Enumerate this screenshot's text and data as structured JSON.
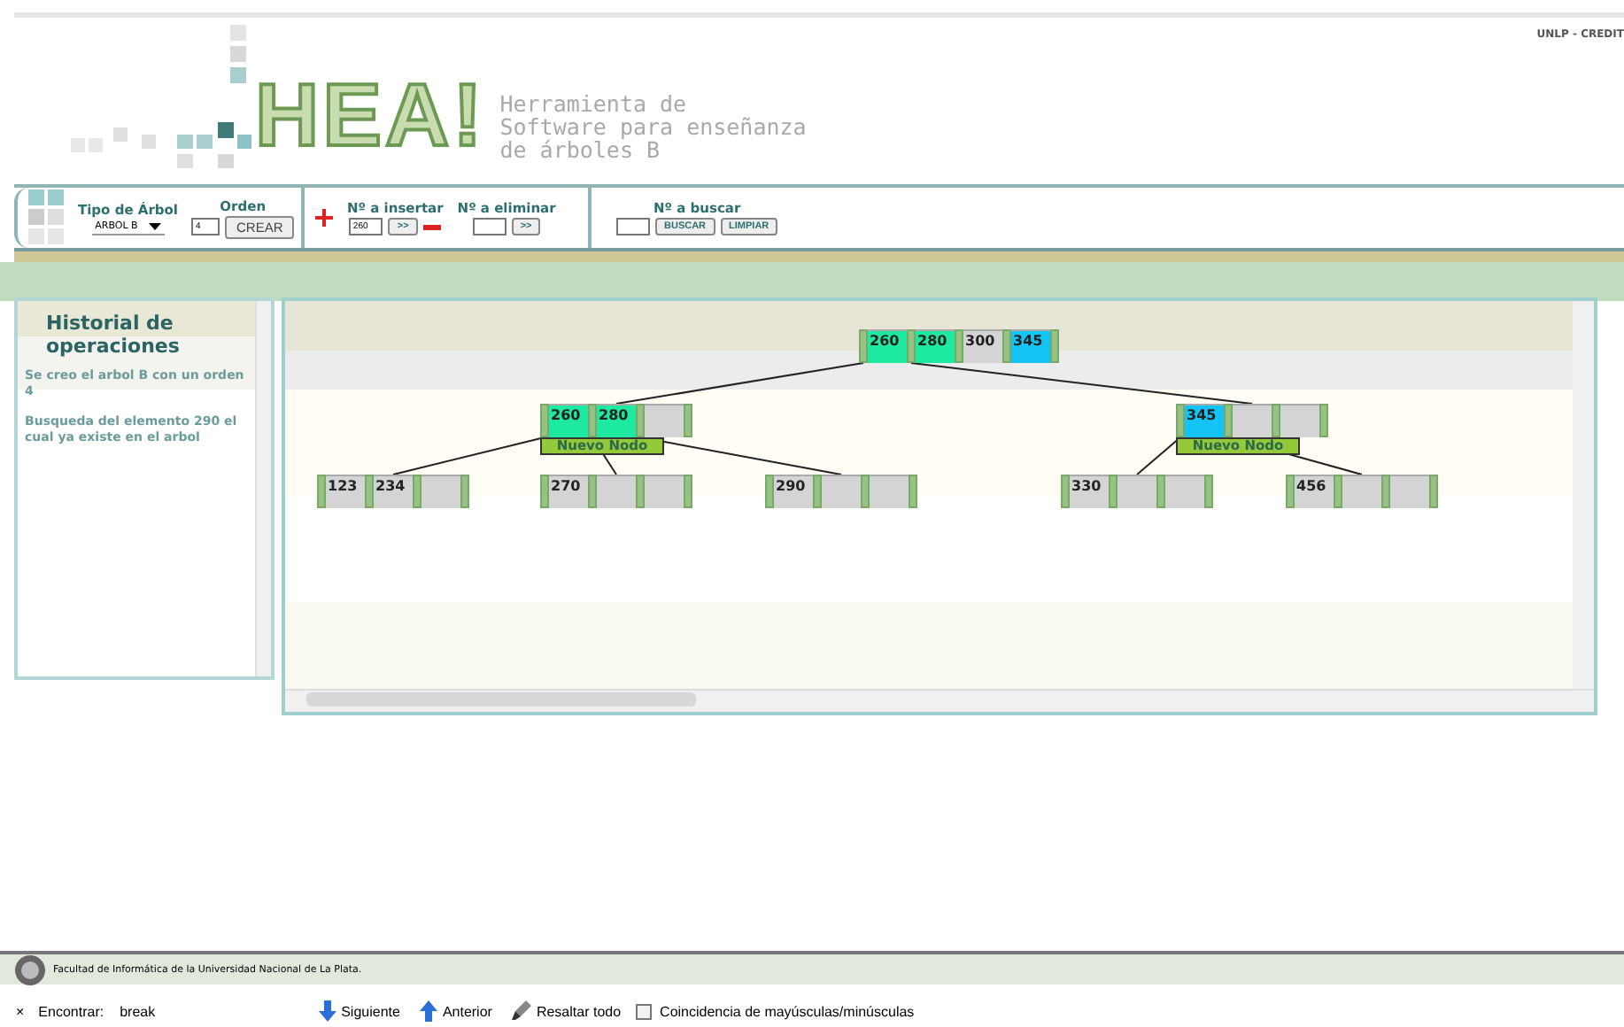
{
  "header": {
    "logo_text": "HEA!",
    "subtitle_lines": [
      "Herramienta de",
      "Software para enseñanza",
      "de árboles B"
    ],
    "credits_link": "UNLP - CREDIT"
  },
  "toolbar": {
    "tree_type": {
      "label": "Tipo de Árbol",
      "value": "ARBOL B"
    },
    "order": {
      "label": "Orden",
      "value": "4"
    },
    "create_button": "CREAR",
    "insert": {
      "label": "Nº a insertar",
      "value": "260",
      "button": ">>"
    },
    "delete": {
      "label": "Nº a eliminar",
      "button": ">>"
    },
    "search": {
      "label": "Nº a buscar",
      "buttons": [
        "BUSCAR",
        "LIMPIAR"
      ]
    }
  },
  "history": {
    "title": "Historial de operaciones",
    "entries": [
      "Se creo el arbol B con un orden 4",
      "Busqueda del elemento 290 el cual ya existe en el arbol"
    ]
  },
  "tree": {
    "root": {
      "keys": [
        {
          "value": "260",
          "color": "#1de9a0"
        },
        {
          "value": "280",
          "color": "#1de9a0"
        },
        {
          "value": "300",
          "color": "#d4d4d4"
        },
        {
          "value": "345",
          "color": "#13c4f5"
        }
      ],
      "children": [
        {
          "keys": [
            {
              "value": "260",
              "color": "#1de9a0"
            },
            {
              "value": "280",
              "color": "#1de9a0"
            }
          ],
          "label": "Nuevo Nodo",
          "children": [
            {
              "keys": [
                {
                  "value": "123",
                  "color": "#d4d4d4"
                },
                {
                  "value": "234",
                  "color": "#d4d4d4"
                }
              ]
            },
            {
              "keys": [
                {
                  "value": "270",
                  "color": "#d4d4d4"
                }
              ]
            },
            {
              "keys": [
                {
                  "value": "290",
                  "color": "#d4d4d4"
                }
              ]
            }
          ]
        },
        {
          "keys": [
            {
              "value": "345",
              "color": "#13c4f5"
            }
          ],
          "label": "Nuevo Nodo",
          "children": [
            {
              "keys": [
                {
                  "value": "330",
                  "color": "#d4d4d4"
                }
              ]
            },
            {
              "keys": [
                {
                  "value": "456",
                  "color": "#d4d4d4"
                }
              ]
            }
          ]
        }
      ]
    }
  },
  "status_bar": "Facultad de Informática de la Universidad Nacional de La Plata.",
  "find_bar": {
    "close": "×",
    "label": "Encontrar:",
    "value": "break",
    "buttons": [
      {
        "label": "Siguiente",
        "kind": "down"
      },
      {
        "label": "Anterior",
        "kind": "up"
      },
      {
        "label": "Resaltar todo",
        "kind": "highlight"
      }
    ],
    "match_case": {
      "label": "Coincidencia de mayúsculas/minúsculas",
      "checked": false
    }
  }
}
